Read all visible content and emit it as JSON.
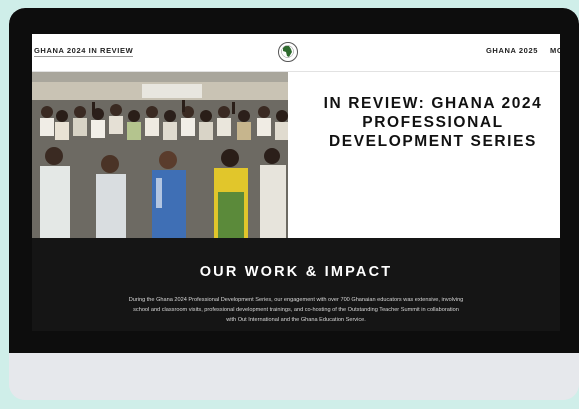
{
  "nav": {
    "left_title": "GHANA 2024 IN REVIEW",
    "right_items": [
      "GHANA 2025",
      "MO"
    ]
  },
  "hero": {
    "title": "IN REVIEW: GHANA 2024\nPROFESSIONAL\nDEVELOPMENT SERIES"
  },
  "impact": {
    "title": "OUR WORK & IMPACT",
    "text": "During the Ghana 2024 Professional Development Series, our engagement with over 700 Ghanaian educators was extensive, involving school and classroom visits, professional development trainings, and co-hosting of the Outstanding Teacher Summit in collaboration with Out International and the Ghana Education Service."
  },
  "colors": {
    "background": "#cfeee9",
    "bezel": "#0d0d0d",
    "impact_bg": "#151515"
  }
}
